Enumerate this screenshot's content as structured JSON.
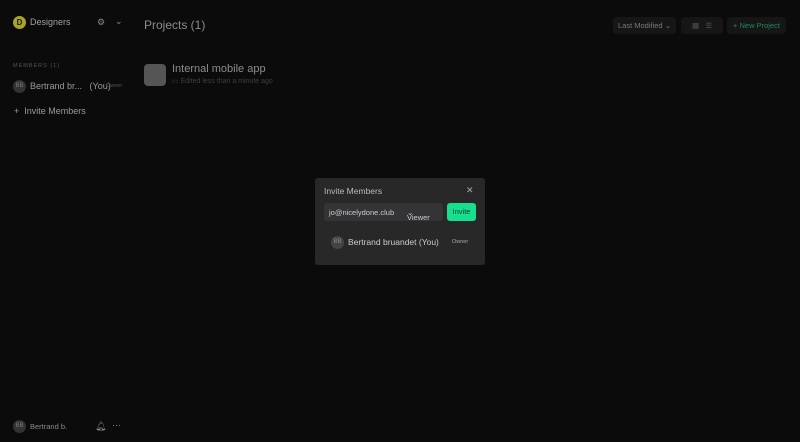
{
  "sidebar": {
    "workspace_initial": "D",
    "workspace_name": "Designers",
    "members_label": "MEMBERS (1)",
    "member": {
      "initials": "BB",
      "name": "Bertrand br...",
      "you": "(You)",
      "role": "Owner"
    },
    "invite_label": "Invite Members",
    "footer": {
      "initials": "BB",
      "name": "Bertrand b."
    }
  },
  "header": {
    "title": "Projects (1)",
    "sort_label": "Last Modified",
    "new_project_label": "New Project"
  },
  "projects": [
    {
      "name": "Internal mobile app",
      "edited": "Edited less than a minute ago"
    }
  ],
  "modal": {
    "title": "Invite Members",
    "email_value": "jo@nicelydone.club",
    "role_value": "Viewer",
    "invite_label": "Invite",
    "member": {
      "initials": "BB",
      "name": "Bertrand bruandet (You)",
      "role": "Owner"
    }
  },
  "colors": {
    "accent": "#16e08e",
    "workspace": "#a8a52a"
  }
}
